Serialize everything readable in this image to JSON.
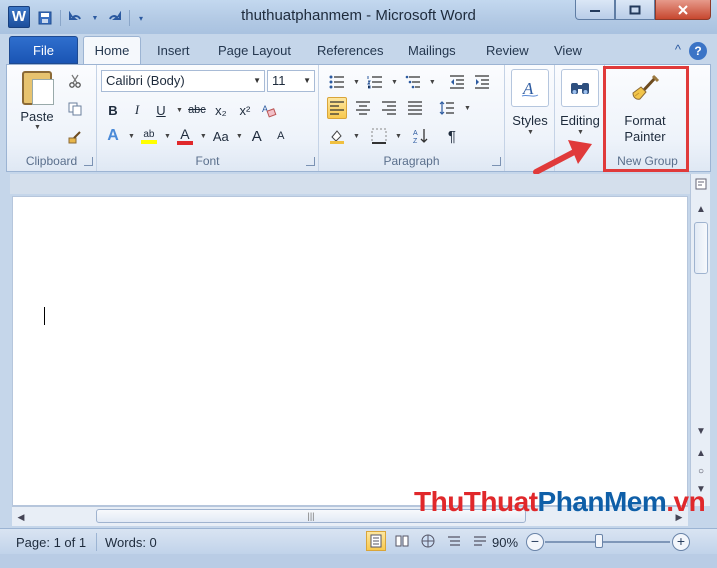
{
  "window": {
    "title": "thuthuatphanmem - Microsoft Word",
    "app_logo_letter": "W"
  },
  "tabs": [
    "File",
    "Home",
    "Insert",
    "Page Layout",
    "References",
    "Mailings",
    "Review",
    "View"
  ],
  "ribbon": {
    "clipboard": {
      "label": "Clipboard",
      "paste_label": "Paste"
    },
    "font": {
      "label": "Font",
      "font_name": "Calibri (Body)",
      "font_size": "11",
      "bold": "B",
      "italic": "I",
      "underline": "U",
      "strikethrough": "abc",
      "subscript": "x₂",
      "superscript": "x²",
      "grow": "A",
      "shrink": "A",
      "change_case": "Aa",
      "highlight": "ab",
      "font_color": "A"
    },
    "paragraph": {
      "label": "Paragraph",
      "pilcrow": "¶"
    },
    "styles": {
      "label": "Styles"
    },
    "editing": {
      "label": "Editing"
    },
    "new_group": {
      "label": "New Group",
      "format_painter_line1": "Format",
      "format_painter_line2": "Painter"
    }
  },
  "status": {
    "page": "Page: 1 of 1",
    "words": "Words: 0",
    "zoom": "90%",
    "zoom_level_percent": 90
  },
  "watermark": {
    "part1": "ThuThuat",
    "part2": "PhanMem",
    "part3": ".vn"
  },
  "colors": {
    "file_tab": "#1a55b4",
    "highlight_box": "#e03a3a",
    "arrow": "#e03a3a",
    "active_button": "#f8c94f"
  }
}
